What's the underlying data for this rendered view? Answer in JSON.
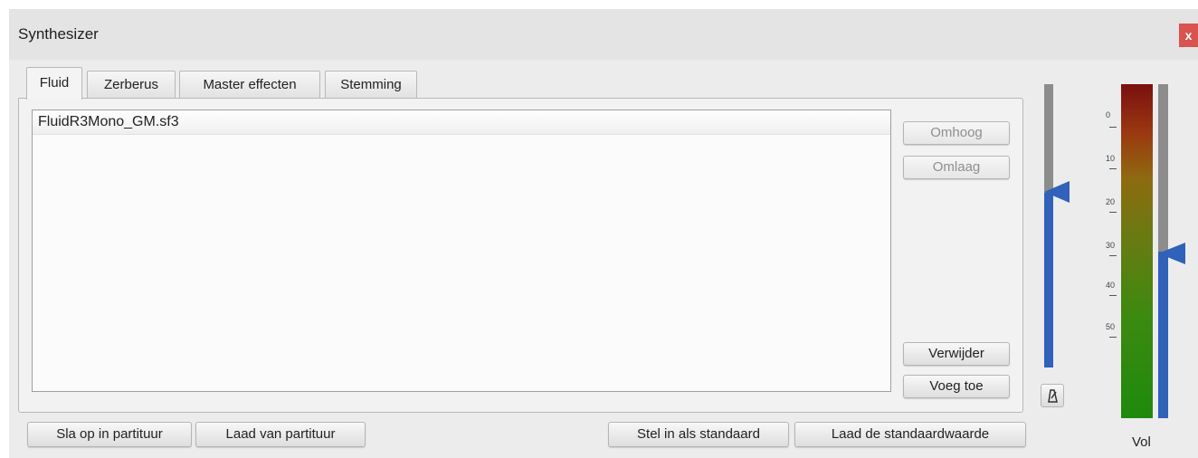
{
  "window": {
    "title": "Synthesizer",
    "close_label": "x"
  },
  "tabs": [
    {
      "label": "Fluid",
      "active": true
    },
    {
      "label": "Zerberus",
      "active": false
    },
    {
      "label": "Master effecten",
      "active": false
    },
    {
      "label": "Stemming",
      "active": false
    }
  ],
  "soundfonts": {
    "items": [
      "FluidR3Mono_GM.sf3"
    ]
  },
  "side_buttons": {
    "up": "Omhoog",
    "down": "Omlaag",
    "remove": "Verwijder",
    "add": "Voeg toe"
  },
  "bottom_buttons": {
    "save_to_score": "Sla op in partituur",
    "load_from_score": "Laad van partituur",
    "set_as_default": "Stel in als standaard",
    "load_default": "Laad de standaardwaarde"
  },
  "metronome": {
    "icon": "metronome-icon"
  },
  "volume": {
    "label": "Vol",
    "scale_ticks": [
      "0",
      "10",
      "20",
      "30",
      "40",
      "50"
    ]
  },
  "colors": {
    "slider_fill": "#2f62b8",
    "slider_track": "#8c8c8c",
    "close_button": "#d9534f"
  }
}
